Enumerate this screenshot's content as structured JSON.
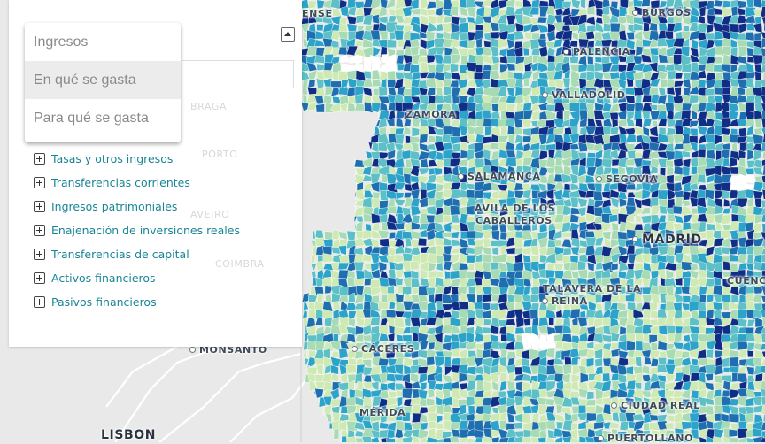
{
  "map": {
    "cities": [
      {
        "name": "BURGOS",
        "dot": true
      },
      {
        "name": "PALENCIA",
        "dot": true
      },
      {
        "name": "VALLADOLID",
        "dot": true
      },
      {
        "name": "ZAMORA",
        "dot": false
      },
      {
        "name": "SALAMANCA",
        "dot": true
      },
      {
        "name": "SEGOVIA",
        "dot": true
      },
      {
        "name": "ÁVILA DE LOS",
        "dot": false
      },
      {
        "name": "CABALLEROS",
        "dot": false
      },
      {
        "name": "MADRID",
        "dot": true
      },
      {
        "name": "CUENCA",
        "dot": false
      },
      {
        "name": "TALAVERA DE LA",
        "dot": false
      },
      {
        "name": "REINA",
        "dot": true
      },
      {
        "name": "CÁCERES",
        "dot": true
      },
      {
        "name": "MONSANTO",
        "dot": true
      },
      {
        "name": "MÉRIDA",
        "dot": false
      },
      {
        "name": "CIUDAD REAL",
        "dot": true
      },
      {
        "name": "PUERTOLLANO",
        "dot": true
      },
      {
        "name": "LISBON",
        "dot": false
      },
      {
        "name": "ENSE",
        "dot": false
      }
    ],
    "faded_labels": [
      "BRAGA",
      "PORTO",
      "AVEIRO",
      "COIMBRA"
    ],
    "colors": {
      "light": "#cfe9b4",
      "pale_green": "#a8dbb4",
      "teal": "#5cc0c6",
      "cyan": "#2ea3c9",
      "blue": "#1f6fb0",
      "navy": "#102e86",
      "land": "#e9e9e9",
      "roads": "#ffffff"
    }
  },
  "panel": {
    "dropdown": {
      "options": [
        "Ingresos",
        "En qué se gasta",
        "Para qué se gasta"
      ],
      "highlighted": "En qué se gasta"
    },
    "tree": [
      "Tasas y otros ingresos",
      "Transferencias corrientes",
      "Ingresos patrimoniales",
      "Enajenación de inversiones reales",
      "Transferencias de capital",
      "Activos financieros",
      "Pasivos financieros"
    ],
    "accent_color": "#1a8596"
  }
}
